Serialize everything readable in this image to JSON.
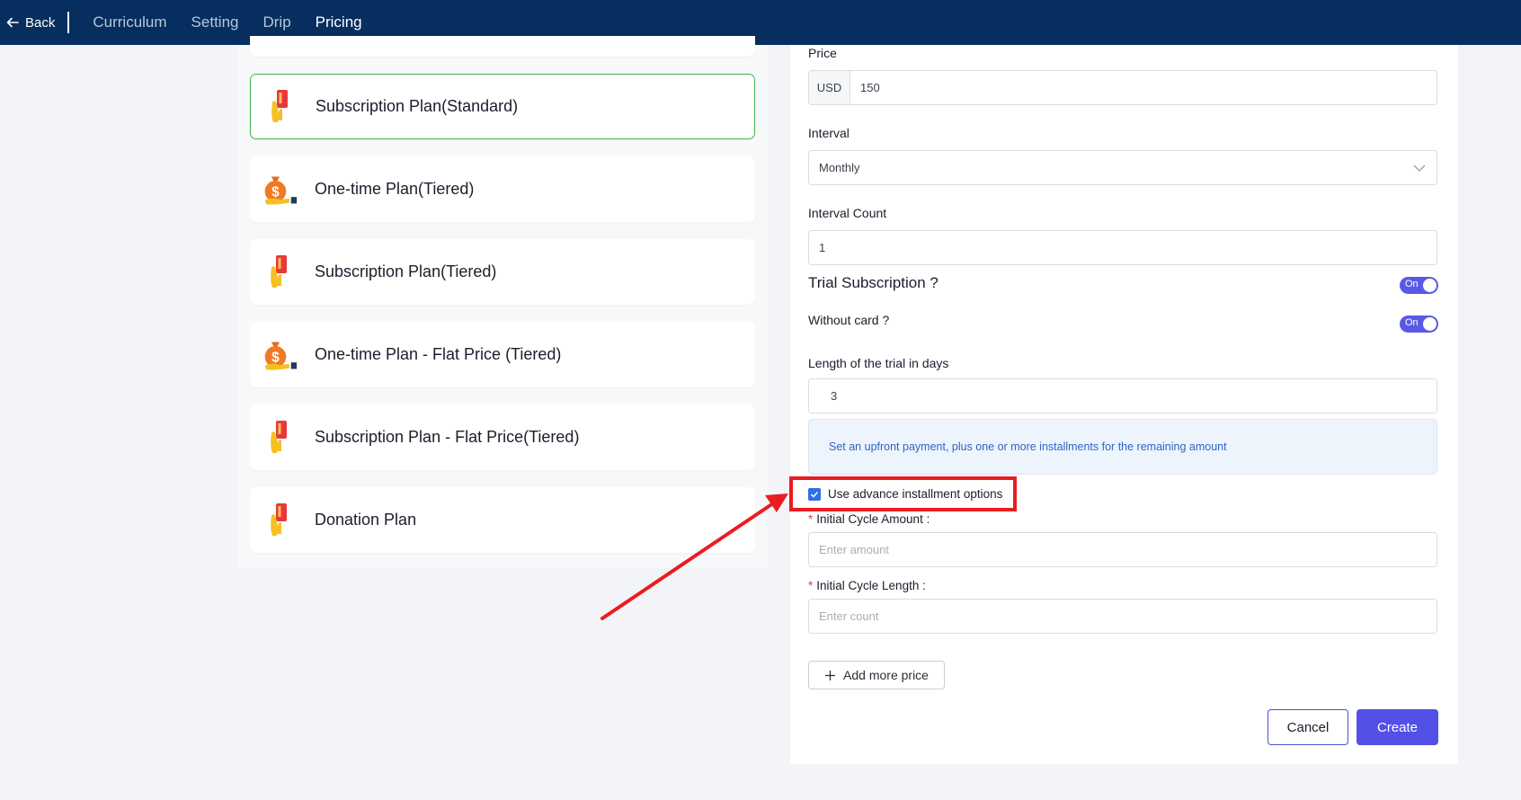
{
  "nav": {
    "back_label": "Back",
    "tabs": [
      {
        "label": "Curriculum",
        "active": false
      },
      {
        "label": "Setting",
        "active": false
      },
      {
        "label": "Drip",
        "active": false
      },
      {
        "label": "Pricing",
        "active": true
      }
    ]
  },
  "plans": [
    {
      "name": "Subscription Plan(Standard)",
      "icon": "card-hand-icon",
      "selected": true
    },
    {
      "name": "One-time Plan(Tiered)",
      "icon": "money-bag-icon",
      "selected": false
    },
    {
      "name": "Subscription Plan(Tiered)",
      "icon": "card-hand-icon",
      "selected": false
    },
    {
      "name": "One-time Plan - Flat Price (Tiered)",
      "icon": "money-bag-icon",
      "selected": false
    },
    {
      "name": "Subscription Plan - Flat Price(Tiered)",
      "icon": "card-hand-icon",
      "selected": false
    },
    {
      "name": "Donation Plan",
      "icon": "card-hand-icon",
      "selected": false
    }
  ],
  "form": {
    "price_label": "Price",
    "currency": "USD",
    "price_value": "150",
    "interval_label": "Interval",
    "interval_value": "Monthly",
    "interval_count_label": "Interval Count",
    "interval_count_value": "1",
    "trial_title": "Trial Subscription ?",
    "trial_toggle": "On",
    "without_card_label": "Without card ?",
    "without_card_toggle": "On",
    "trial_length_label": "Length of the trial in days",
    "trial_length_value": "3",
    "installment_info": "Set an upfront payment, plus one or more installments for the remaining amount",
    "advance_installment_label": "Use advance installment options",
    "advance_installment_checked": true,
    "initial_cycle_amount_label": "Initial Cycle Amount",
    "initial_cycle_amount_placeholder": "Enter amount",
    "initial_cycle_length_label": "Initial Cycle Length",
    "initial_cycle_length_placeholder": "Enter count",
    "add_more_price_label": "Add more price",
    "cancel_label": "Cancel",
    "create_label": "Create"
  },
  "colors": {
    "nav_bg": "#062e5e",
    "accent": "#5350e8",
    "selected_border": "#47b34d",
    "annotation_red": "#ea1c22"
  }
}
